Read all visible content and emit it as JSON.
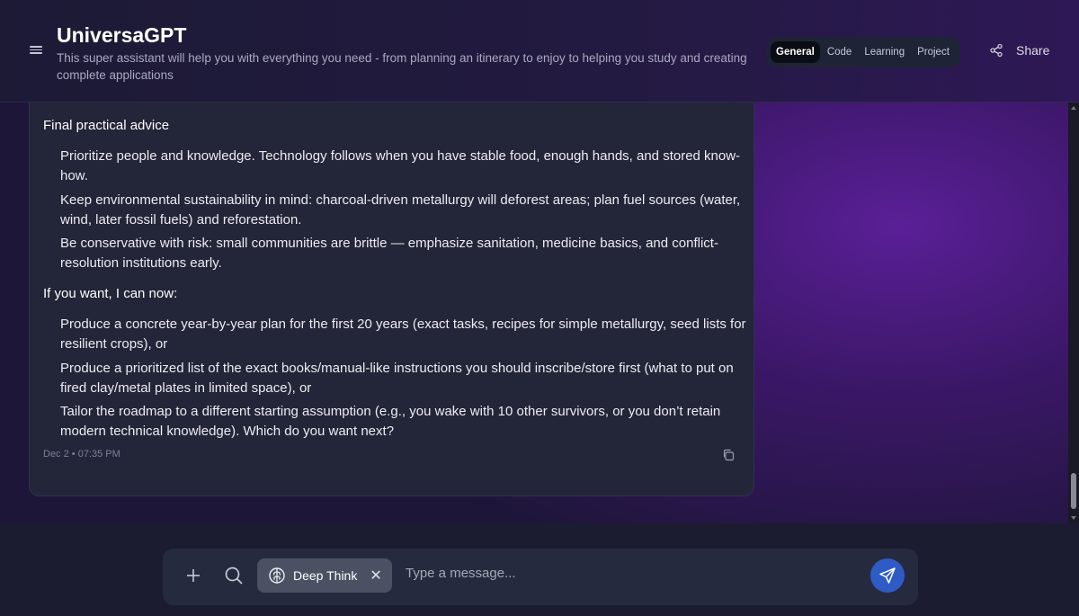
{
  "header": {
    "title": "UniversaGPT",
    "subtitle": "This super assistant will help you with everything you need - from planning an itinerary to enjoy to helping you study and creating complete applications",
    "menu_icon": "hamburger-menu-icon",
    "modes": [
      {
        "label": "General",
        "active": true
      },
      {
        "label": "Code",
        "active": false
      },
      {
        "label": "Learning",
        "active": false
      },
      {
        "label": "Project",
        "active": false
      }
    ],
    "share_label": "Share",
    "share_icon": "share-icon"
  },
  "message": {
    "clipped_text": "… …, … …, …",
    "sections": [
      {
        "heading": "Final practical advice",
        "items": [
          "Prioritize people and knowledge. Technology follows when you have stable food, enough hands, and stored know-how.",
          "Keep environmental sustainability in mind: charcoal-driven metallurgy will deforest areas; plan fuel sources (water, wind, later fossil fuels) and reforestation.",
          "Be conservative with risk: small communities are brittle — emphasize sanitation, medicine basics, and conflict-resolution institutions early."
        ]
      },
      {
        "heading": "If you want, I can now:",
        "items": [
          "Produce a concrete year-by-year plan for the first 20 years (exact tasks, recipes for simple metallurgy, seed lists for resilient crops), or",
          "Produce a prioritized list of the exact books/manual-like instructions you should inscribe/store first (what to put on fired clay/metal plates in limited space), or",
          "Tailor the roadmap to a different starting assumption (e.g., you wake with 10 other survivors, or you don’t retain modern technical knowledge). Which do you want next?"
        ]
      }
    ],
    "timestamp": "Dec 2 • 07:35 PM",
    "copy_icon": "copy-icon"
  },
  "composer": {
    "plus_icon": "plus-icon",
    "search_icon": "search-icon",
    "deepthink_label": "Deep Think",
    "deepthink_icon": "brain-icon",
    "deepthink_close": "✕",
    "placeholder": "Type a message...",
    "value": "",
    "send_icon": "send-icon"
  },
  "colors": {
    "accent": "#2f5bc7",
    "bubble": "#232538",
    "purple_glow": "#5a1f97"
  }
}
